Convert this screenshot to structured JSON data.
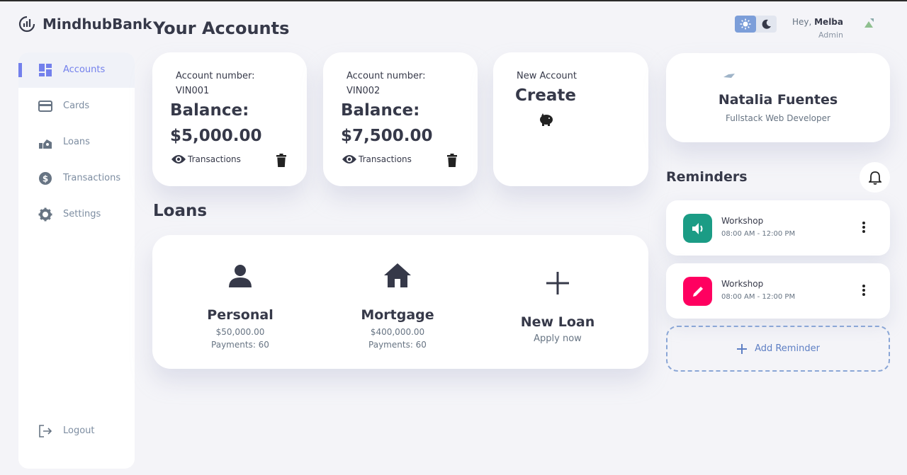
{
  "brand": {
    "name": "MindhubBank"
  },
  "header": {
    "greeting": "Hey,",
    "user_name": "Melba",
    "role": "Admin"
  },
  "page": {
    "title": "Your Accounts",
    "loans_title": "Loans"
  },
  "sidebar": {
    "items": [
      {
        "label": "Accounts",
        "icon": "dashboard-icon",
        "active": true
      },
      {
        "label": "Cards",
        "icon": "credit-card-icon"
      },
      {
        "label": "Loans",
        "icon": "money-hand-icon"
      },
      {
        "label": "Transactions",
        "icon": "dollar-circle-icon"
      },
      {
        "label": "Settings",
        "icon": "gear-icon"
      }
    ],
    "logout": "Logout"
  },
  "accounts": [
    {
      "number_label": "Account number:",
      "number": "VIN001",
      "balance_label": "Balance:",
      "balance": "$5,000.00",
      "transactions_label": "Transactions"
    },
    {
      "number_label": "Account number:",
      "number": "VIN002",
      "balance_label": "Balance:",
      "balance": "$7,500.00",
      "transactions_label": "Transactions"
    }
  ],
  "new_account": {
    "label": "New Account",
    "action": "Create"
  },
  "loans": [
    {
      "name": "Personal",
      "amount": "$50,000.00",
      "payments": "Payments: 60",
      "icon": "user-icon"
    },
    {
      "name": "Mortgage",
      "amount": "$400,000.00",
      "payments": "Payments: 60",
      "icon": "house-icon"
    },
    {
      "name": "New Loan",
      "subtitle": "Apply now",
      "icon": "plus-icon"
    }
  ],
  "profile": {
    "name": "Natalia Fuentes",
    "role": "Fullstack Web Developer"
  },
  "reminders": {
    "title": "Reminders",
    "items": [
      {
        "title": "Workshop",
        "time": "08:00 AM - 12:00 PM",
        "icon": "volume-icon",
        "color": "#1b9c85"
      },
      {
        "title": "Workshop",
        "time": "08:00 AM - 12:00 PM",
        "icon": "pencil-icon",
        "color": "#ff0060"
      }
    ],
    "add_label": "Add Reminder"
  },
  "colors": {
    "accent": "#7380ec",
    "text": "#363949",
    "background": "#f4f4f8"
  }
}
